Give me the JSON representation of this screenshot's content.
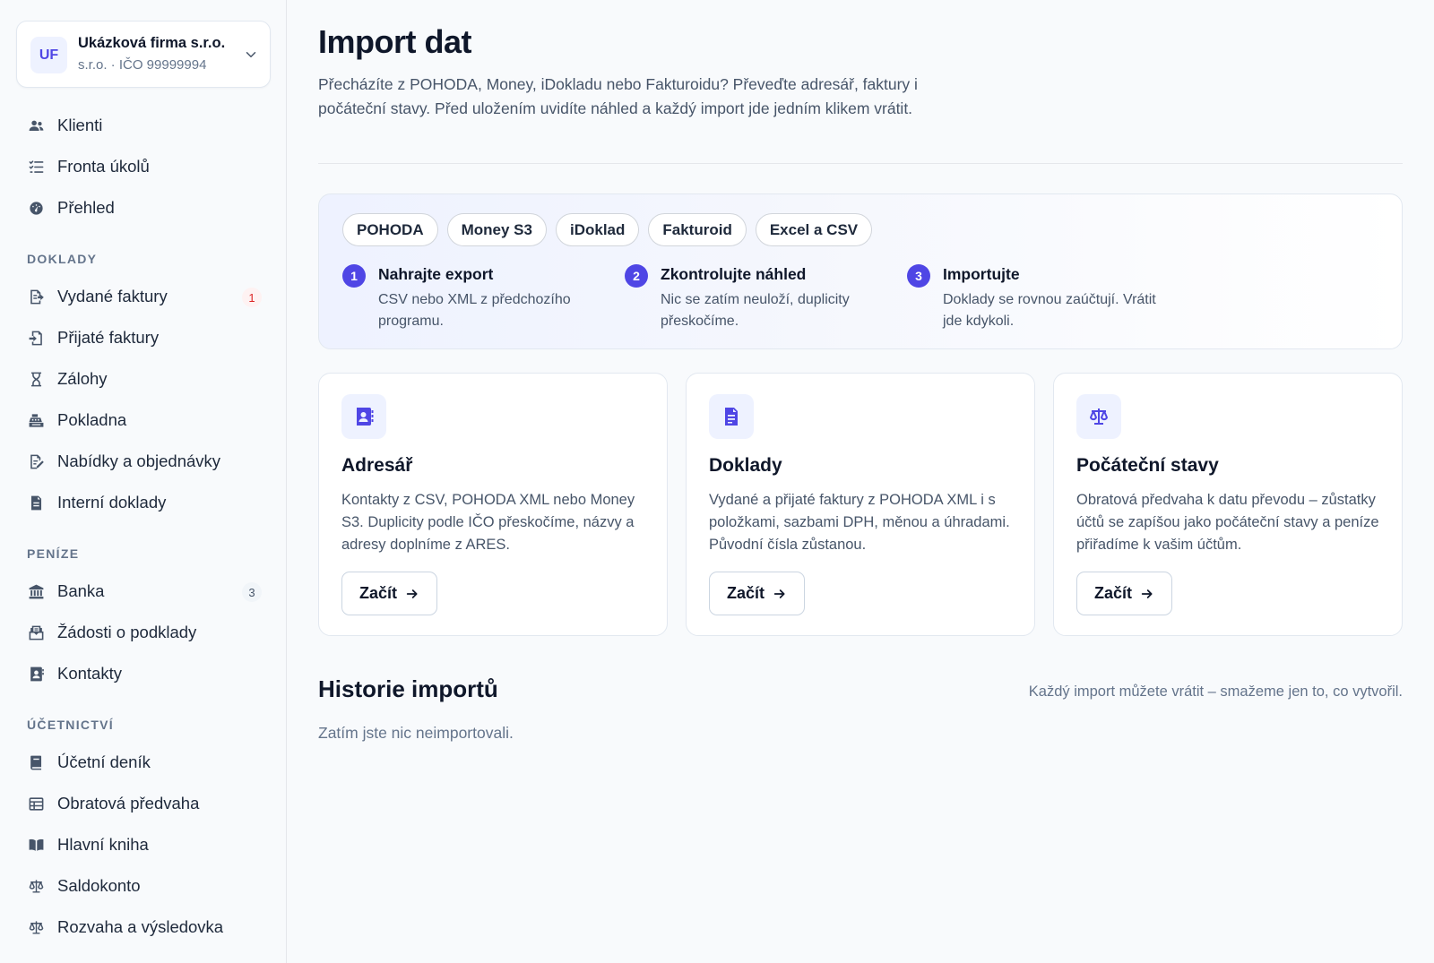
{
  "company": {
    "initials": "UF",
    "name": "Ukázková firma s.r.o.",
    "sub": "s.r.o. · IČO 99999994"
  },
  "sidebar": {
    "top": [
      {
        "label": "Klienti",
        "icon": "users-icon"
      },
      {
        "label": "Fronta úkolů",
        "icon": "task-list-icon"
      },
      {
        "label": "Přehled",
        "icon": "dashboard-icon"
      }
    ],
    "sections": [
      {
        "title": "DOKLADY",
        "items": [
          {
            "label": "Vydané faktury",
            "icon": "invoice-out-icon",
            "badge": "1"
          },
          {
            "label": "Přijaté faktury",
            "icon": "invoice-in-icon"
          },
          {
            "label": "Zálohy",
            "icon": "hourglass-icon"
          },
          {
            "label": "Pokladna",
            "icon": "cash-register-icon"
          },
          {
            "label": "Nabídky a objednávky",
            "icon": "edit-document-icon"
          },
          {
            "label": "Interní doklady",
            "icon": "document-icon"
          }
        ]
      },
      {
        "title": "PENÍZE",
        "items": [
          {
            "label": "Banka",
            "icon": "bank-icon",
            "badge": "3"
          },
          {
            "label": "Žádosti o podklady",
            "icon": "inbox-icon"
          },
          {
            "label": "Kontakty",
            "icon": "contact-icon"
          }
        ]
      },
      {
        "title": "ÚČETNICTVÍ",
        "items": [
          {
            "label": "Účetní deník",
            "icon": "book-icon"
          },
          {
            "label": "Obratová předvaha",
            "icon": "table-icon"
          },
          {
            "label": "Hlavní kniha",
            "icon": "open-book-icon"
          },
          {
            "label": "Saldokonto",
            "icon": "scale-icon"
          },
          {
            "label": "Rozvaha a výsledovka",
            "icon": "scale-icon"
          }
        ]
      }
    ]
  },
  "page": {
    "title": "Import dat",
    "intro": "Přecházíte z POHODA, Money, iDokladu nebo Fakturoidu? Převeďte adresář, faktury i počáteční stavy. Před uložením uvidíte náhled a každý import jde jedním klikem vrátit."
  },
  "sources": [
    "POHODA",
    "Money S3",
    "iDoklad",
    "Fakturoid",
    "Excel a CSV"
  ],
  "steps": [
    {
      "num": "1",
      "title": "Nahrajte export",
      "desc": "CSV nebo XML z předchozího programu."
    },
    {
      "num": "2",
      "title": "Zkontrolujte náhled",
      "desc": "Nic se zatím neuloží, duplicity přeskočíme."
    },
    {
      "num": "3",
      "title": "Importujte",
      "desc": "Doklady se rovnou zaúčtují. Vrátit jde kdykoli."
    }
  ],
  "cards": [
    {
      "title": "Adresář",
      "icon": "address-book-icon",
      "desc": "Kontakty z CSV, POHODA XML nebo Money S3. Duplicity podle IČO přeskočíme, názvy a adresy doplníme z ARES.",
      "button": "Začít"
    },
    {
      "title": "Doklady",
      "icon": "document-icon",
      "desc": "Vydané a přijaté faktury z POHODA XML i s položkami, sazbami DPH, měnou a úhradami. Původní čísla zůstanou.",
      "button": "Začít"
    },
    {
      "title": "Počáteční stavy",
      "icon": "scale-icon",
      "desc": "Obratová předvaha k datu převodu – zůstatky účtů se zapíšou jako počáteční stavy a peníze přiřadíme k vašim účtům.",
      "button": "Začít"
    }
  ],
  "history": {
    "title": "Historie importů",
    "note": "Každý import můžete vrátit – smažeme jen to, co vytvořil.",
    "empty": "Zatím jste nic neimportovali."
  },
  "colors": {
    "accent": "#4f46e5",
    "badge_red": "#dc2626"
  }
}
